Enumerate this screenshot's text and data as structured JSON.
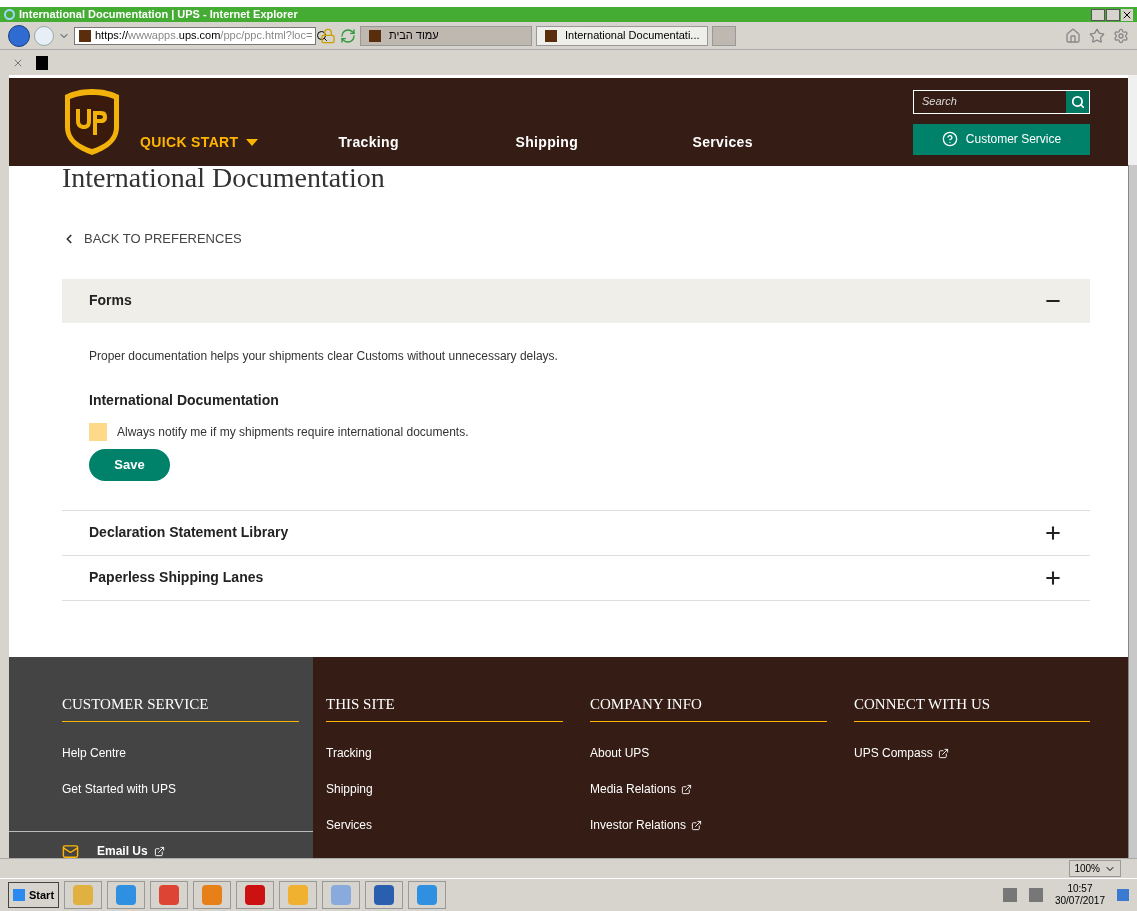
{
  "browser": {
    "title": "International Documentation | UPS - Internet Explorer",
    "address": {
      "scheme": "https://",
      "host_pre": "wwwapps.",
      "host": "ups.com",
      "path": "/ppc/ppc.html?loc="
    },
    "tabs": [
      {
        "label": "עמוד הבית",
        "selected": false
      },
      {
        "label": "International Documentati...",
        "selected": true
      }
    ],
    "zoom": "100%"
  },
  "header": {
    "quick_start": "QUICK START",
    "nav": [
      "Tracking",
      "Shipping",
      "Services"
    ],
    "search": {
      "placeholder": "Search"
    },
    "customer_service": "Customer Service"
  },
  "page": {
    "title": "International Documentation",
    "back": "BACK TO PREFERENCES",
    "sections": [
      {
        "title": "Forms",
        "expanded": true,
        "description": "Proper documentation helps your shipments clear Customs without unnecessary delays.",
        "subheading": "International Documentation",
        "checkbox": {
          "label": "Always notify me if my shipments require international documents.",
          "checked": false
        },
        "button": "Save"
      },
      {
        "title": "Declaration Statement Library",
        "expanded": false
      },
      {
        "title": "Paperless Shipping Lanes",
        "expanded": false
      }
    ]
  },
  "footer": {
    "columns": [
      {
        "heading": "CUSTOMER SERVICE",
        "links": [
          {
            "label": "Help Centre",
            "external": false
          },
          {
            "label": "Get Started with UPS",
            "external": false
          }
        ]
      },
      {
        "heading": "THIS SITE",
        "links": [
          {
            "label": "Tracking",
            "external": false
          },
          {
            "label": "Shipping",
            "external": false
          },
          {
            "label": "Services",
            "external": false
          }
        ]
      },
      {
        "heading": "COMPANY INFO",
        "links": [
          {
            "label": "About UPS",
            "external": false
          },
          {
            "label": "Media Relations",
            "external": true
          },
          {
            "label": "Investor Relations",
            "external": true
          }
        ]
      },
      {
        "heading": "CONNECT WITH US",
        "links": [
          {
            "label": "UPS Compass",
            "external": true
          }
        ]
      }
    ],
    "email": "Email Us"
  },
  "taskbar": {
    "start": "Start",
    "time": "10:57",
    "date": "30/07/2017"
  }
}
